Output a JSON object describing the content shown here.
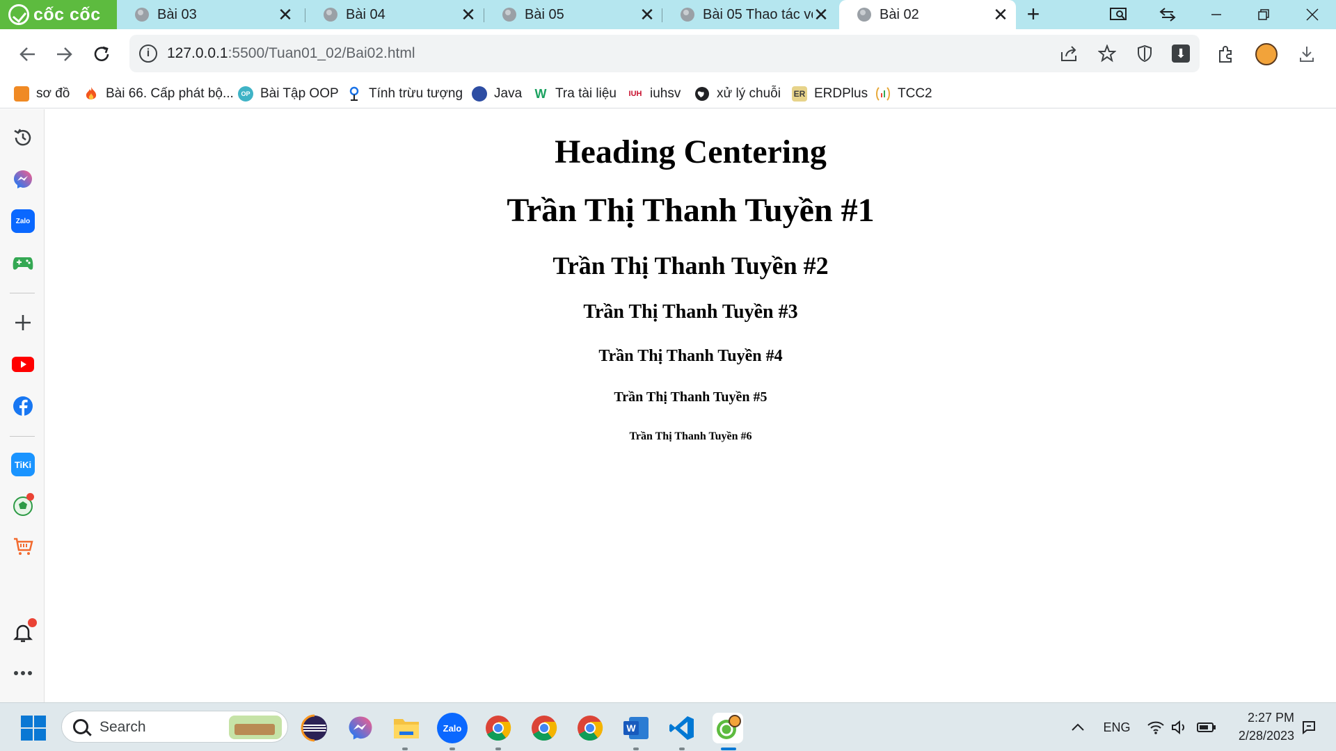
{
  "browser": {
    "brand": "cốc cốc",
    "tabs": [
      {
        "title": "Bài 03",
        "active": false
      },
      {
        "title": "Bài 04",
        "active": false
      },
      {
        "title": "Bài 05",
        "active": false
      },
      {
        "title": "Bài 05 Thao tác vớ",
        "active": false
      },
      {
        "title": "Bài 02",
        "active": true
      }
    ],
    "tab_close_glyph": "✕",
    "new_tab_glyph": "+",
    "address": {
      "host": "127.0.0.1",
      "path": ":5500/Tuan01_02/Bai02.html",
      "info_glyph": "i"
    }
  },
  "bookmarks": [
    {
      "label": "sơ đồ",
      "icon": "diagram-icon",
      "color": "#f08a24"
    },
    {
      "label": "Bài 66. Cấp phát bộ...",
      "icon": "fire-icon",
      "color": "#f2551d"
    },
    {
      "label": "Bài Tập OOP",
      "icon": "oop-icon",
      "color": "#3fb3c6"
    },
    {
      "label": "Tính trừu tượng",
      "icon": "pin-icon",
      "color": "#1a73e8"
    },
    {
      "label": "Java",
      "icon": "java-icon",
      "color": "#2d4da3"
    },
    {
      "label": "Tra tài liệu",
      "icon": "w-icon",
      "color": "#1aa260"
    },
    {
      "label": "iuhsv",
      "icon": "iuh-icon",
      "color": "#c8102e"
    },
    {
      "label": "xử lý chuỗi",
      "icon": "globe-icon",
      "color": "#202124"
    },
    {
      "label": "ERDPlus",
      "icon": "erdplus-icon",
      "color": "#e7d38a"
    },
    {
      "label": "TCC2",
      "icon": "tcc2-icon",
      "color": "#e7a93a"
    }
  ],
  "sidebar": [
    {
      "name": "history-icon",
      "color": "#3c4043"
    },
    {
      "name": "messenger-icon",
      "color": "#7b5cff"
    },
    {
      "name": "zalo-icon",
      "color": "#0a68ff"
    },
    {
      "name": "game-icon",
      "color": "#34a853"
    },
    {
      "name": "add-icon",
      "color": "#3c4043"
    },
    {
      "name": "youtube-icon",
      "color": "#ff0000"
    },
    {
      "name": "facebook-icon",
      "color": "#1877f2"
    },
    {
      "name": "tiki-icon",
      "color": "#1a94ff"
    },
    {
      "name": "football-icon",
      "color": "#2e9b46"
    },
    {
      "name": "shop-icon",
      "color": "#f26a2e"
    },
    {
      "name": "bell-icon",
      "color": "#3c4043"
    },
    {
      "name": "more-icon",
      "color": "#3c4043"
    }
  ],
  "page": {
    "headings": [
      "Heading Centering",
      "Trần Thị Thanh Tuyền #1",
      "Trần Thị Thanh Tuyền #2",
      "Trần Thị Thanh Tuyền #3",
      "Trần Thị Thanh Tuyền #4",
      "Trần Thị Thanh Tuyền #5",
      "Trần Thị Thanh Tuyền #6"
    ]
  },
  "taskbar": {
    "search_placeholder": "Search",
    "apps": [
      "eclipse-icon",
      "messenger-icon",
      "file-explorer-icon",
      "zalo-icon",
      "chrome-icon",
      "chrome-icon",
      "chrome-icon",
      "word-icon",
      "vscode-icon",
      "coccoc-icon"
    ],
    "tray": {
      "language": "ENG"
    },
    "clock": {
      "time": "2:27 PM",
      "date": "2/28/2023"
    }
  }
}
